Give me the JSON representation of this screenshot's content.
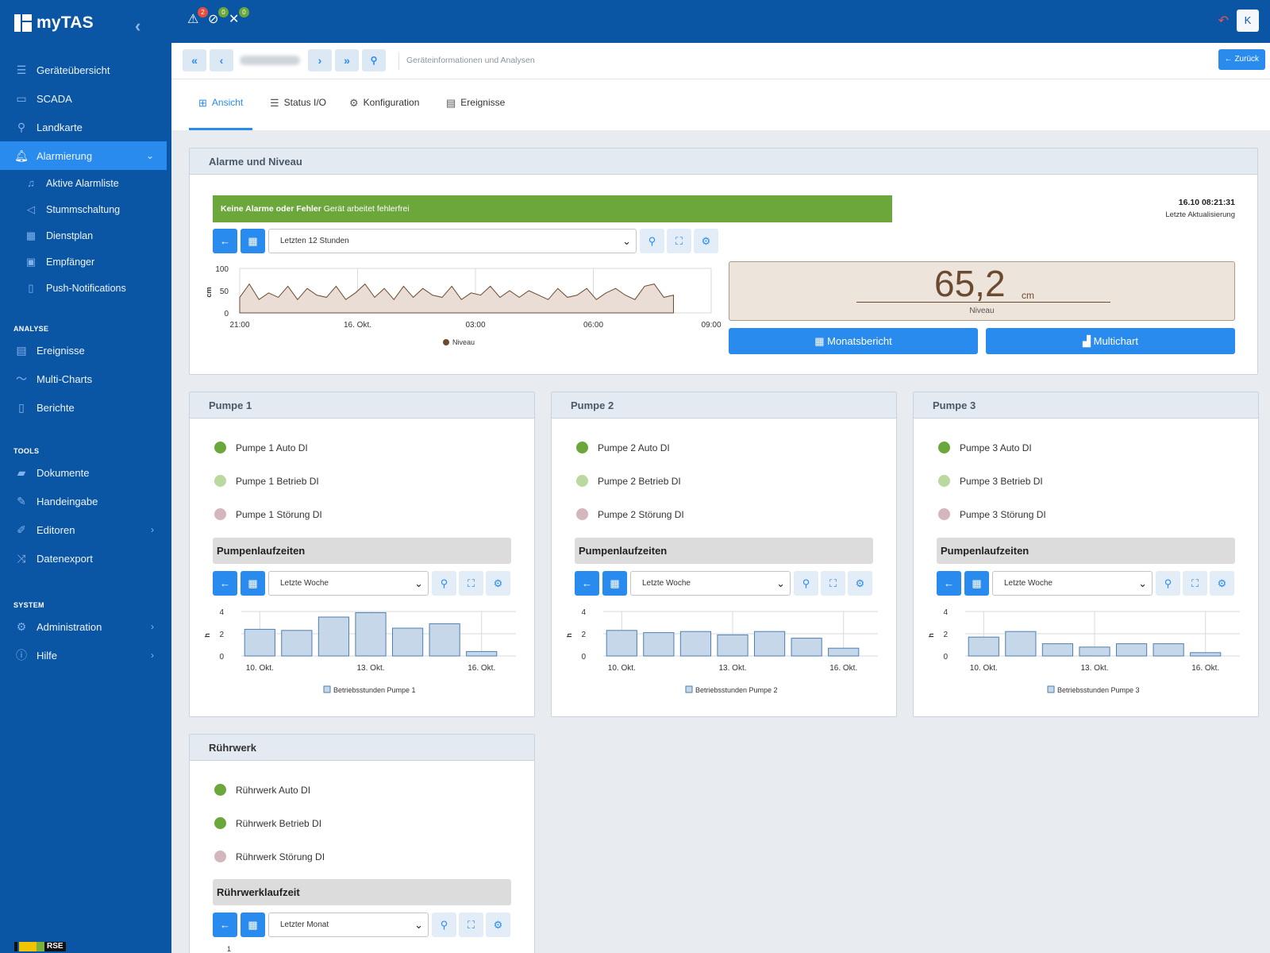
{
  "app": {
    "name": "myTAS"
  },
  "sidebar": {
    "items": [
      {
        "label": "Geräteübersicht",
        "icon": "list-icon"
      },
      {
        "label": "SCADA",
        "icon": "monitor-icon"
      },
      {
        "label": "Landkarte",
        "icon": "map-pin-icon"
      },
      {
        "label": "Alarmierung",
        "icon": "bell-icon"
      }
    ],
    "alarm_sub": [
      {
        "label": "Aktive Alarmliste",
        "icon": "bell-icon"
      },
      {
        "label": "Stummschaltung",
        "icon": "speaker-mute-icon"
      },
      {
        "label": "Dienstplan",
        "icon": "calendar-icon"
      },
      {
        "label": "Empfänger",
        "icon": "address-book-icon"
      },
      {
        "label": "Push-Notifications",
        "icon": "mobile-icon"
      }
    ],
    "sections": {
      "analyse": "ANALYSE",
      "tools": "TOOLS",
      "system": "SYSTEM"
    },
    "analyse_items": [
      {
        "label": "Ereignisse",
        "icon": "list-alt-icon"
      },
      {
        "label": "Multi-Charts",
        "icon": "line-chart-icon"
      },
      {
        "label": "Berichte",
        "icon": "document-icon"
      }
    ],
    "tools_items": [
      {
        "label": "Dokumente",
        "icon": "folder-icon"
      },
      {
        "label": "Handeingabe",
        "icon": "pencil-icon"
      },
      {
        "label": "Editoren",
        "icon": "edit-icon"
      },
      {
        "label": "Datenexport",
        "icon": "shuffle-icon"
      }
    ],
    "system_items": [
      {
        "label": "Administration",
        "icon": "cogs-icon"
      },
      {
        "label": "Hilfe",
        "icon": "info-icon"
      }
    ],
    "footer_logo": "RSE"
  },
  "topbar": {
    "badges": [
      {
        "count": "2",
        "color": "#e74c3c"
      },
      {
        "count": "0",
        "color": "#6ca73b"
      },
      {
        "count": "0",
        "color": "#6ca73b"
      }
    ],
    "user_initial": "K"
  },
  "breadcrumb": {
    "title": "Geräteinformationen und Analysen",
    "back": "Zurück"
  },
  "tabs": [
    {
      "label": "Ansicht",
      "icon": "table-icon"
    },
    {
      "label": "Status I/O",
      "icon": "bars-icon"
    },
    {
      "label": "Konfiguration",
      "icon": "gear-icon"
    },
    {
      "label": "Ereignisse",
      "icon": "list-alt-icon"
    }
  ],
  "alarme": {
    "title": "Alarme und Niveau",
    "status_bold": "Keine Alarme oder Fehler",
    "status_text": "Gerät arbeitet fehlerfrei",
    "update_time": "16.10 08:21:31",
    "update_label": "Letzte Aktualisierung",
    "range": "Letzten 12 Stunden",
    "level_value": "65,2",
    "level_unit": "cm",
    "level_label": "Niveau",
    "btn_month": "Monatsbericht",
    "btn_multi": "Multichart"
  },
  "colors": {
    "primary": "#2a8bef",
    "sidebar": "#0b56a4",
    "ok": "#6ca73b",
    "dot_on": "#6ca73b",
    "dot_light": "#b9d9a0",
    "dot_fault": "#d4b6bd",
    "level_bg": "#ede4dc"
  },
  "pumps": [
    {
      "title": "Pumpe 1",
      "signals": [
        {
          "label": "Pumpe 1 Auto DI",
          "state": "on"
        },
        {
          "label": "Pumpe 1 Betrieb DI",
          "state": "light"
        },
        {
          "label": "Pumpe 1 Störung DI",
          "state": "fault"
        }
      ],
      "section": "Pumpenlaufzeiten",
      "range": "Letzte Woche",
      "legend": "Betriebsstunden Pumpe 1"
    },
    {
      "title": "Pumpe 2",
      "signals": [
        {
          "label": "Pumpe 2 Auto DI",
          "state": "on"
        },
        {
          "label": "Pumpe 2 Betrieb DI",
          "state": "light"
        },
        {
          "label": "Pumpe 2 Störung DI",
          "state": "fault"
        }
      ],
      "section": "Pumpenlaufzeiten",
      "range": "Letzte Woche",
      "legend": "Betriebsstunden Pumpe 2"
    },
    {
      "title": "Pumpe 3",
      "signals": [
        {
          "label": "Pumpe 3 Auto DI",
          "state": "on"
        },
        {
          "label": "Pumpe 3 Betrieb DI",
          "state": "light"
        },
        {
          "label": "Pumpe 3 Störung DI",
          "state": "fault"
        }
      ],
      "section": "Pumpenlaufzeiten",
      "range": "Letzte Woche",
      "legend": "Betriebsstunden Pumpe 3"
    }
  ],
  "ruehrwerk": {
    "title": "Rührwerk",
    "signals": [
      {
        "label": "Rührwerk Auto DI",
        "state": "on"
      },
      {
        "label": "Rührwerk Betrieb DI",
        "state": "on"
      },
      {
        "label": "Rührwerk Störung DI",
        "state": "fault"
      }
    ],
    "section": "Rührwerklaufzeit",
    "range": "Letzter Monat"
  },
  "chart_data": [
    {
      "type": "area",
      "title": "",
      "ylabel": "cm",
      "ylim": [
        0,
        100
      ],
      "x_ticks": [
        "21:00",
        "16. Okt.",
        "03:00",
        "06:00",
        "09:00"
      ],
      "series": [
        {
          "name": "Niveau",
          "values": [
            35,
            65,
            30,
            45,
            35,
            60,
            30,
            55,
            40,
            35,
            60,
            30,
            45,
            65,
            35,
            55,
            30,
            60,
            35,
            55,
            40,
            35,
            60,
            30,
            45,
            40,
            60,
            35,
            50,
            35,
            50,
            40,
            30,
            55,
            35,
            40,
            55,
            30,
            45,
            55,
            40,
            30,
            60,
            65,
            35,
            40
          ]
        }
      ],
      "legend": "bottom"
    },
    {
      "type": "bar",
      "ylabel": "h",
      "ylim": [
        0,
        4
      ],
      "categories": [
        "10. Okt.",
        "11. Okt.",
        "12. Okt.",
        "13. Okt.",
        "14. Okt.",
        "15. Okt.",
        "16. Okt."
      ],
      "x_ticks": [
        "10. Okt.",
        "13. Okt.",
        "16. Okt."
      ],
      "y_ticks": [
        "0",
        "2",
        "4"
      ],
      "series": [
        {
          "name": "Betriebsstunden Pumpe 1",
          "values": [
            2.4,
            2.3,
            3.5,
            3.9,
            2.5,
            2.9,
            0.4
          ]
        }
      ]
    },
    {
      "type": "bar",
      "ylabel": "h",
      "ylim": [
        0,
        4
      ],
      "categories": [
        "10. Okt.",
        "11. Okt.",
        "12. Okt.",
        "13. Okt.",
        "14. Okt.",
        "15. Okt.",
        "16. Okt."
      ],
      "x_ticks": [
        "10. Okt.",
        "13. Okt.",
        "16. Okt."
      ],
      "y_ticks": [
        "0",
        "2",
        "4"
      ],
      "series": [
        {
          "name": "Betriebsstunden Pumpe 2",
          "values": [
            2.3,
            2.1,
            2.2,
            1.9,
            2.2,
            1.6,
            0.7
          ]
        }
      ]
    },
    {
      "type": "bar",
      "ylabel": "h",
      "ylim": [
        0,
        4
      ],
      "categories": [
        "10. Okt.",
        "11. Okt.",
        "12. Okt.",
        "13. Okt.",
        "14. Okt.",
        "15. Okt.",
        "16. Okt."
      ],
      "x_ticks": [
        "10. Okt.",
        "13. Okt.",
        "16. Okt."
      ],
      "y_ticks": [
        "0",
        "2",
        "4"
      ],
      "series": [
        {
          "name": "Betriebsstunden Pumpe 3",
          "values": [
            1.7,
            2.2,
            1.1,
            0.8,
            1.1,
            1.1,
            0.3
          ]
        }
      ]
    }
  ],
  "ruehrwerk_chart_first_tick": "1"
}
